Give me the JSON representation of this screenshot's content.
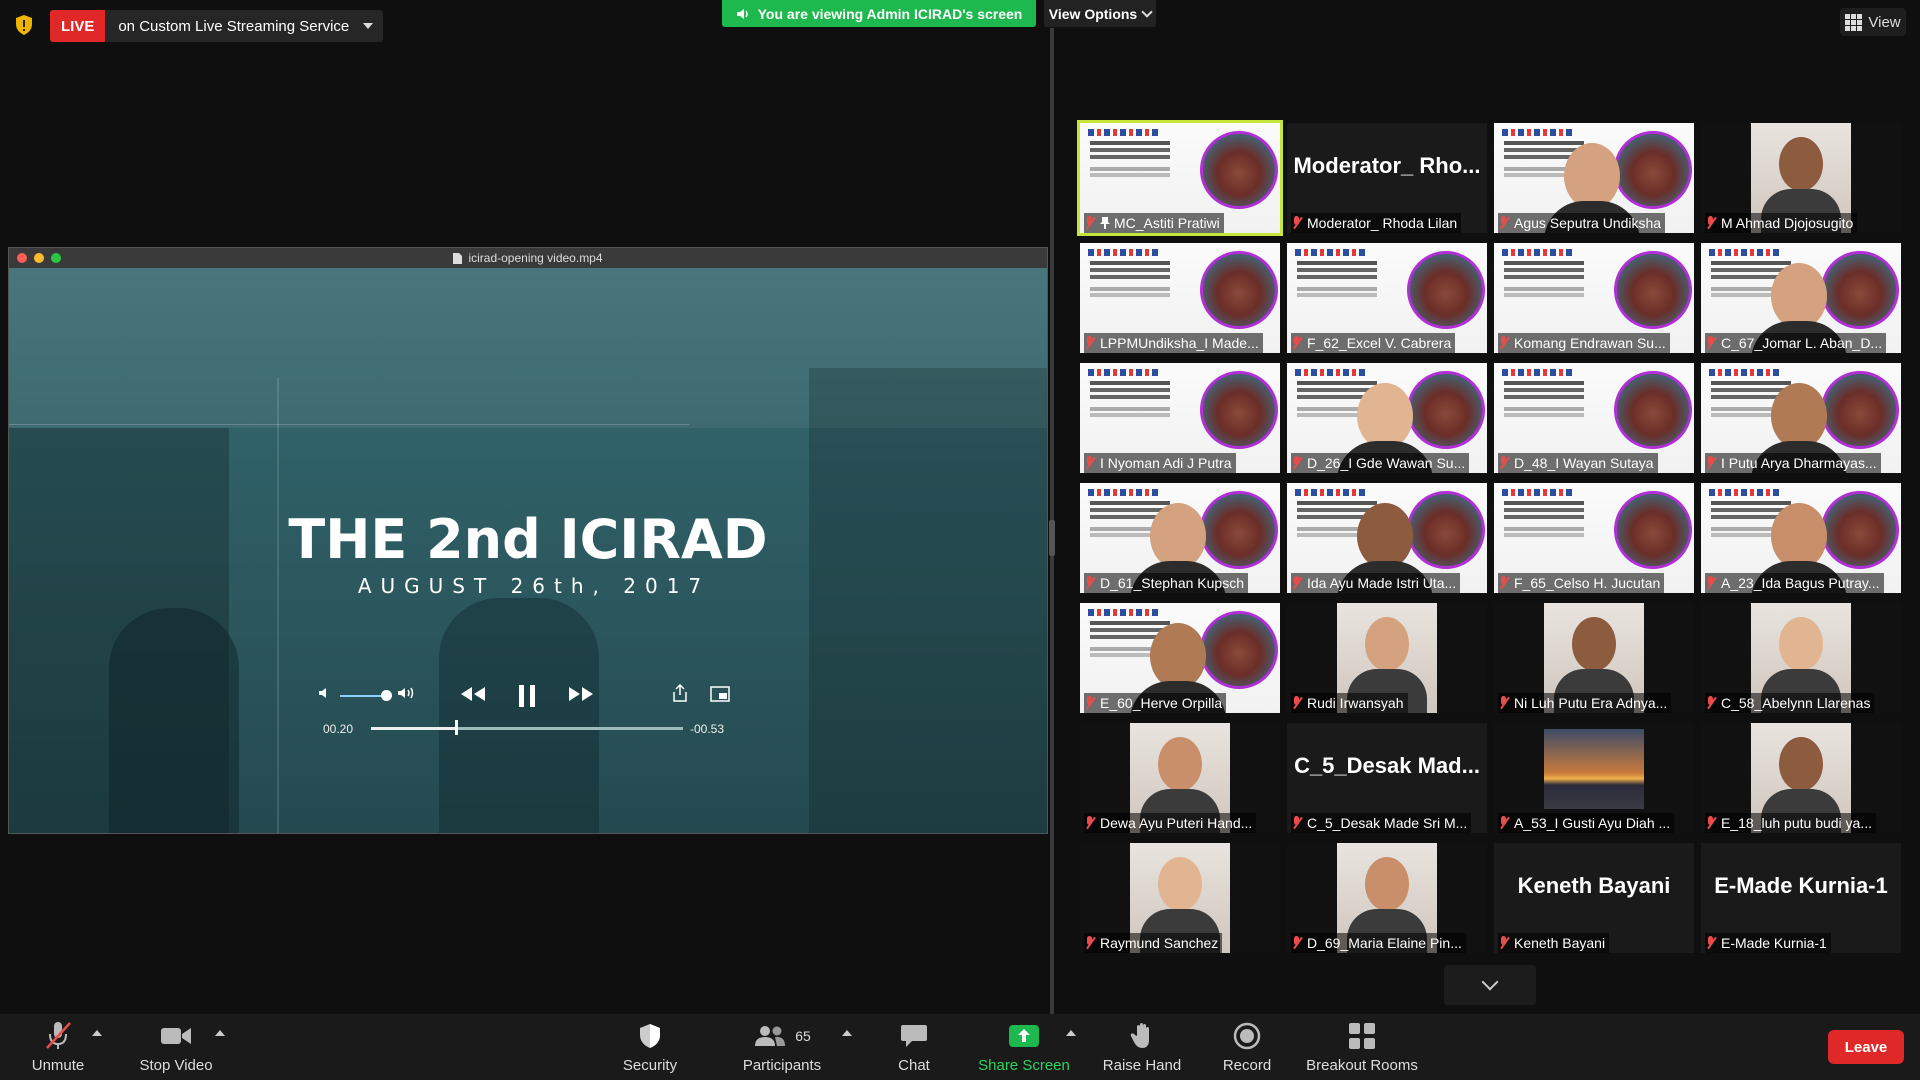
{
  "top_bar": {
    "live_badge": "LIVE",
    "live_service": "on Custom Live Streaming Service",
    "viewing_banner": "You are viewing Admin ICIRAD's screen",
    "view_options": "View Options",
    "view_button": "View"
  },
  "shared_screen": {
    "window_title": "icirad-opening video.mp4",
    "video_title": "THE 2nd ICIRAD",
    "video_subtitle": "AUGUST 26th, 2017",
    "elapsed": "00.20",
    "remaining": "-00.53",
    "progress": 0.275
  },
  "participants": [
    {
      "label": "MC_Astiti Pratiwi",
      "tile": "slide",
      "active": true,
      "pinned": true
    },
    {
      "label": "Moderator_ Rhoda Lilan",
      "tile": "text",
      "big": "Moderator_ Rho..."
    },
    {
      "label": "Agus Seputra Undiksha",
      "tile": "slide-face"
    },
    {
      "label": "M Ahmad Djojosugito",
      "tile": "photo"
    },
    {
      "label": "LPPMUndiksha_I Made...",
      "tile": "slide"
    },
    {
      "label": "F_62_Excel V. Cabrera",
      "tile": "slide"
    },
    {
      "label": "Komang Endrawan Su...",
      "tile": "slide"
    },
    {
      "label": "C_67_Jomar L. Aban_D...",
      "tile": "slide-face"
    },
    {
      "label": "I Nyoman Adi J Putra",
      "tile": "slide"
    },
    {
      "label": "D_26_I Gde Wawan Su...",
      "tile": "slide-face"
    },
    {
      "label": "D_48_I Wayan Sutaya",
      "tile": "slide"
    },
    {
      "label": "I Putu Arya Dharmayas...",
      "tile": "slide-face"
    },
    {
      "label": "D_61_Stephan Kupsch",
      "tile": "slide-face"
    },
    {
      "label": "Ida Ayu Made Istri Uta...",
      "tile": "slide-face"
    },
    {
      "label": "F_65_Celso H. Jucutan",
      "tile": "slide"
    },
    {
      "label": "A_23_Ida Bagus Putray...",
      "tile": "slide-face"
    },
    {
      "label": "E_60_Herve Orpilla",
      "tile": "slide-face"
    },
    {
      "label": "Rudi Irwansyah",
      "tile": "photo"
    },
    {
      "label": "Ni Luh Putu Era Adnya...",
      "tile": "photo"
    },
    {
      "label": "C_58_Abelynn Llarenas",
      "tile": "photo"
    },
    {
      "label": "Dewa Ayu Puteri Hand...",
      "tile": "photo"
    },
    {
      "label": "C_5_Desak Made Sri M...",
      "tile": "text",
      "big": "C_5_Desak  Mad..."
    },
    {
      "label": "A_53_I Gusti Ayu Diah ...",
      "tile": "sunset"
    },
    {
      "label": "E_18_luh putu budi ya...",
      "tile": "photo"
    },
    {
      "label": "Raymund Sanchez",
      "tile": "photo"
    },
    {
      "label": "D_69_Maria Elaine Pin...",
      "tile": "photo"
    },
    {
      "label": "Keneth Bayani",
      "tile": "text",
      "big": "Keneth Bayani"
    },
    {
      "label": "E-Made Kurnia-1",
      "tile": "text",
      "big": "E-Made Kurnia-1"
    }
  ],
  "toolbar": {
    "unmute": "Unmute",
    "stop_video": "Stop Video",
    "security": "Security",
    "participants": "Participants",
    "participants_count": "65",
    "chat": "Chat",
    "share_screen": "Share Screen",
    "raise_hand": "Raise Hand",
    "record": "Record",
    "breakout_rooms": "Breakout Rooms",
    "leave": "Leave"
  },
  "colors": {
    "live_red": "#e02828",
    "viewing_green": "#1db84e",
    "share_green": "#1db84e",
    "active_speaker": "#c5e639",
    "muted_mic": "#e84c4c"
  }
}
